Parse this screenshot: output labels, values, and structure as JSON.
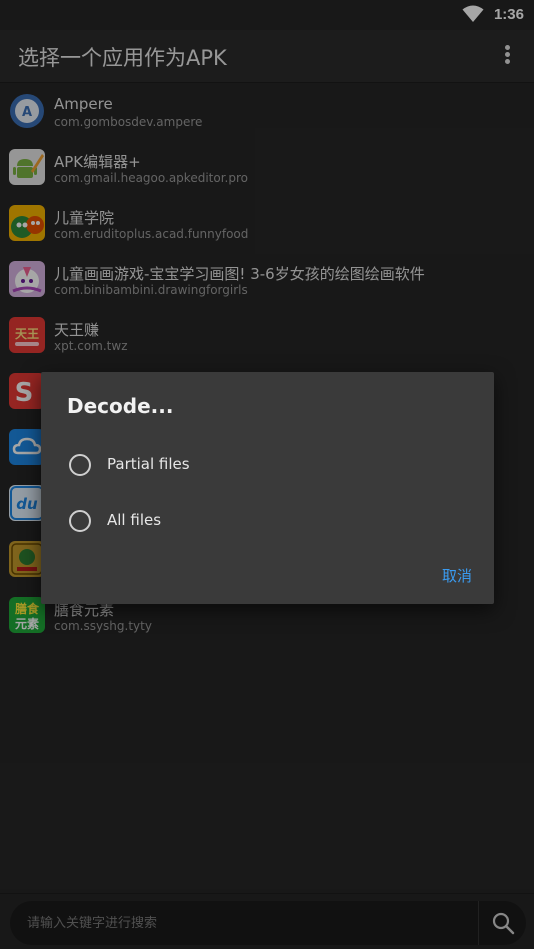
{
  "status_bar": {
    "time": "1:36"
  },
  "appbar": {
    "title": "选择一个应用作为APK"
  },
  "apps": [
    {
      "name": "Ampere",
      "package": "com.gombosdev.ampere",
      "icon": "ampere-icon"
    },
    {
      "name": "APK编辑器+",
      "package": "com.gmail.heagoo.apkeditor.pro",
      "icon": "android-icon"
    },
    {
      "name": "儿童学院",
      "package": "com.eruditoplus.acad.funnyfood",
      "icon": "fruit-icon"
    },
    {
      "name": "儿童画画游戏-宝宝学习画图! 3-6岁女孩的绘图绘画软件",
      "package": "com.binibambini.drawingforgirls",
      "icon": "unicorn-icon"
    },
    {
      "name": "天王赚",
      "package": "xpt.com.twz",
      "icon": "tianwang-icon"
    },
    {
      "name": "",
      "package": "",
      "icon": "s-logo-icon"
    },
    {
      "name": "",
      "package": "",
      "icon": "cloud-icon"
    },
    {
      "name": "",
      "package": "",
      "icon": "du-icon"
    },
    {
      "name": "",
      "package": "",
      "icon": "lottery-icon"
    },
    {
      "name": "膳食元素",
      "package": "com.ssyshg.tyty",
      "icon": "shanshi-icon"
    }
  ],
  "dialog": {
    "title": "Decode...",
    "options": [
      {
        "label": "Partial files",
        "selected": false
      },
      {
        "label": "All files",
        "selected": false
      }
    ],
    "cancel_label": "取消"
  },
  "search": {
    "placeholder": "请输入关键字进行搜索"
  },
  "colors": {
    "background": "#262626",
    "dialog": "#3a3a3a",
    "accent": "#3a9bf0"
  }
}
